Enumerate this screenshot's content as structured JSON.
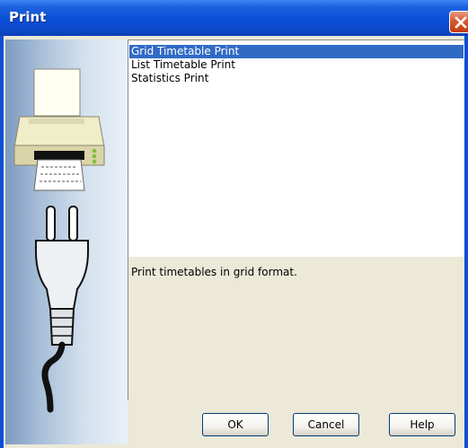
{
  "window": {
    "title": "Print"
  },
  "print_types": {
    "items": [
      {
        "label": "Grid Timetable Print",
        "selected": true
      },
      {
        "label": "List Timetable Print",
        "selected": false
      },
      {
        "label": "Statistics Print",
        "selected": false
      }
    ]
  },
  "description": {
    "text": "Print timetables in grid format."
  },
  "buttons": {
    "ok": "OK",
    "cancel": "Cancel",
    "help": "Help"
  },
  "icons": {
    "close": "close-icon",
    "printer": "printer-icon",
    "plug": "power-plug-icon"
  },
  "colors": {
    "titlebar": "#0a4fd6",
    "selection": "#316ac5",
    "dialog_bg": "#ece9d8",
    "close_button": "#d9582f"
  }
}
